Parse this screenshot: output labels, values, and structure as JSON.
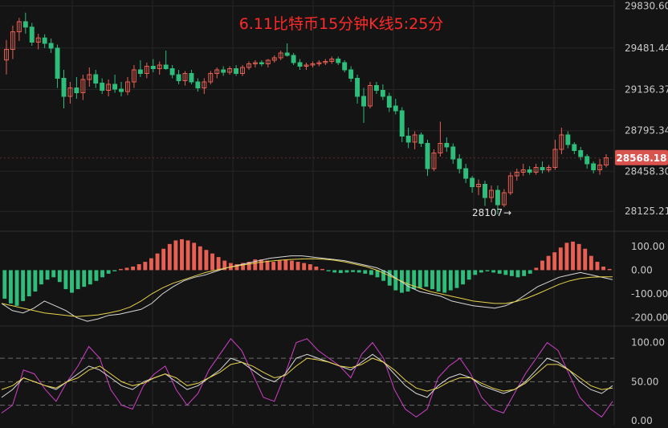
{
  "chart_data": {
    "type": "candlestick",
    "title": "6.11比特币15分钟K线5:25分",
    "colors": {
      "background": "#141414",
      "up": "#e85f53",
      "down": "#2ebd7a",
      "grid": "#262626",
      "fast_line": "#d8d8d8",
      "slow_line": "#e8d24a",
      "stoch_j": "#d040c8",
      "badge": "#d9534f"
    },
    "price_axis": {
      "ylim": [
        27960,
        29880
      ],
      "ticks": [
        "29830.60",
        "29481.44",
        "29136.37",
        "28795.34",
        "28458.30",
        "28125.21"
      ],
      "tick_values": [
        29830.6,
        29481.44,
        29136.37,
        28795.34,
        28458.3,
        28125.21
      ]
    },
    "current_price": {
      "label": "28568.18",
      "value": 28568.18
    },
    "low_annotation": {
      "label": "28107",
      "value": 28107
    },
    "candles": [
      [
        29382,
        29548,
        29262,
        29470
      ],
      [
        29470,
        29668,
        29390,
        29616
      ],
      [
        29616,
        29732,
        29540,
        29700
      ],
      [
        29700,
        29775,
        29600,
        29655
      ],
      [
        29655,
        29690,
        29500,
        29530
      ],
      [
        29530,
        29600,
        29470,
        29565
      ],
      [
        29565,
        29595,
        29480,
        29520
      ],
      [
        29520,
        29560,
        29440,
        29480
      ],
      [
        29480,
        29510,
        29150,
        29230
      ],
      [
        29230,
        29300,
        28980,
        29080
      ],
      [
        29080,
        29200,
        29020,
        29150
      ],
      [
        29150,
        29240,
        29060,
        29110
      ],
      [
        29110,
        29260,
        29050,
        29220
      ],
      [
        29220,
        29320,
        29160,
        29260
      ],
      [
        29260,
        29300,
        29150,
        29190
      ],
      [
        29190,
        29230,
        29100,
        29130
      ],
      [
        29130,
        29220,
        29080,
        29180
      ],
      [
        29180,
        29260,
        29110,
        29140
      ],
      [
        29140,
        29200,
        29080,
        29120
      ],
      [
        29120,
        29240,
        29090,
        29200
      ],
      [
        29200,
        29340,
        29150,
        29300
      ],
      [
        29300,
        29380,
        29240,
        29270
      ],
      [
        29270,
        29360,
        29230,
        29330
      ],
      [
        29330,
        29390,
        29280,
        29310
      ],
      [
        29310,
        29370,
        29260,
        29340
      ],
      [
        29340,
        29460,
        29300,
        29310
      ],
      [
        29310,
        29340,
        29230,
        29260
      ],
      [
        29260,
        29300,
        29180,
        29210
      ],
      [
        29210,
        29290,
        29170,
        29270
      ],
      [
        29270,
        29300,
        29180,
        29200
      ],
      [
        29200,
        29230,
        29120,
        29150
      ],
      [
        29150,
        29230,
        29100,
        29200
      ],
      [
        29200,
        29290,
        29180,
        29270
      ],
      [
        29270,
        29320,
        29230,
        29300
      ],
      [
        29300,
        29330,
        29250,
        29280
      ],
      [
        29280,
        29330,
        29260,
        29310
      ],
      [
        29310,
        29340,
        29250,
        29270
      ],
      [
        29270,
        29340,
        29250,
        29320
      ],
      [
        29320,
        29370,
        29300,
        29350
      ],
      [
        29350,
        29380,
        29320,
        29360
      ],
      [
        29360,
        29380,
        29330,
        29350
      ],
      [
        29350,
        29390,
        29320,
        29380
      ],
      [
        29380,
        29420,
        29360,
        29400
      ],
      [
        29400,
        29460,
        29380,
        29440
      ],
      [
        29440,
        29520,
        29410,
        29420
      ],
      [
        29420,
        29440,
        29340,
        29360
      ],
      [
        29360,
        29390,
        29300,
        29330
      ],
      [
        29330,
        29360,
        29300,
        29340
      ],
      [
        29340,
        29370,
        29320,
        29350
      ],
      [
        29350,
        29380,
        29330,
        29360
      ],
      [
        29360,
        29390,
        29340,
        29370
      ],
      [
        29370,
        29410,
        29350,
        29390
      ],
      [
        29390,
        29410,
        29340,
        29360
      ],
      [
        29360,
        29380,
        29280,
        29300
      ],
      [
        29300,
        29330,
        29200,
        29230
      ],
      [
        29230,
        29260,
        29020,
        29080
      ],
      [
        29080,
        29150,
        28860,
        29000
      ],
      [
        29000,
        29200,
        28980,
        29170
      ],
      [
        29170,
        29200,
        29100,
        29130
      ],
      [
        29130,
        29180,
        29050,
        29080
      ],
      [
        29080,
        29110,
        28950,
        28990
      ],
      [
        29000,
        29060,
        28930,
        28960
      ],
      [
        28960,
        28990,
        28700,
        28750
      ],
      [
        28750,
        28820,
        28650,
        28700
      ],
      [
        28700,
        28790,
        28640,
        28760
      ],
      [
        28760,
        28780,
        28660,
        28690
      ],
      [
        28690,
        28720,
        28420,
        28480
      ],
      [
        28480,
        28640,
        28460,
        28610
      ],
      [
        28610,
        28870,
        28580,
        28690
      ],
      [
        28690,
        28740,
        28620,
        28660
      ],
      [
        28660,
        28690,
        28520,
        28560
      ],
      [
        28560,
        28600,
        28440,
        28480
      ],
      [
        28480,
        28520,
        28360,
        28400
      ],
      [
        28400,
        28420,
        28280,
        28330
      ],
      [
        28330,
        28390,
        28260,
        28350
      ],
      [
        28350,
        28380,
        28170,
        28240
      ],
      [
        28240,
        28340,
        28200,
        28300
      ],
      [
        28300,
        28340,
        28100,
        28180
      ],
      [
        28180,
        28310,
        28160,
        28280
      ],
      [
        28280,
        28450,
        28260,
        28420
      ],
      [
        28420,
        28480,
        28380,
        28450
      ],
      [
        28450,
        28520,
        28420,
        28470
      ],
      [
        28470,
        28500,
        28430,
        28450
      ],
      [
        28450,
        28520,
        28430,
        28490
      ],
      [
        28490,
        28540,
        28440,
        28470
      ],
      [
        28470,
        28510,
        28450,
        28490
      ],
      [
        28490,
        28720,
        28470,
        28640
      ],
      [
        28640,
        28820,
        28600,
        28760
      ],
      [
        28760,
        28790,
        28650,
        28680
      ],
      [
        28680,
        28700,
        28600,
        28630
      ],
      [
        28630,
        28660,
        28550,
        28580
      ],
      [
        28580,
        28600,
        28480,
        28520
      ],
      [
        28520,
        28540,
        28440,
        28470
      ],
      [
        28470,
        28560,
        28430,
        28510
      ],
      [
        28510,
        28600,
        28490,
        28570
      ]
    ],
    "macd": {
      "axis_ticks": [
        "100.00",
        "0.00",
        "-100.00",
        "-200.00"
      ],
      "axis_values": [
        100,
        0,
        -100,
        -200
      ],
      "ylim": [
        -235,
        150
      ],
      "histogram": [
        -120,
        -140,
        -150,
        -130,
        -110,
        -90,
        -60,
        -40,
        -30,
        -50,
        -80,
        -95,
        -80,
        -70,
        -60,
        -45,
        -30,
        -15,
        -5,
        5,
        10,
        15,
        25,
        35,
        50,
        70,
        90,
        110,
        125,
        130,
        125,
        115,
        100,
        85,
        70,
        55,
        40,
        30,
        25,
        30,
        35,
        45,
        45,
        40,
        35,
        40,
        45,
        40,
        35,
        30,
        25,
        15,
        5,
        -5,
        -10,
        -12,
        -10,
        -8,
        -10,
        -15,
        -20,
        -30,
        -45,
        -65,
        -85,
        -95,
        -90,
        -80,
        -75,
        -70,
        -80,
        -90,
        -95,
        -85,
        -75,
        -60,
        -40,
        -20,
        -10,
        -5,
        -10,
        -15,
        -20,
        -25,
        -30,
        -25,
        -15,
        10,
        40,
        60,
        75,
        95,
        115,
        120,
        110,
        90,
        60,
        35,
        15,
        5
      ],
      "fast_line": [
        -140,
        -170,
        -180,
        -160,
        -130,
        -150,
        -170,
        -200,
        -215,
        -205,
        -190,
        -185,
        -175,
        -165,
        -140,
        -100,
        -70,
        -45,
        -30,
        -20,
        -5,
        10,
        20,
        30,
        40,
        50,
        55,
        60,
        60,
        55,
        50,
        45,
        40,
        30,
        20,
        10,
        -10,
        -40,
        -70,
        -90,
        -100,
        -110,
        -130,
        -140,
        -150,
        -155,
        -160,
        -150,
        -130,
        -100,
        -70,
        -50,
        -30,
        -20,
        -10,
        -20,
        -30,
        -40
      ],
      "slow_line": [
        -140,
        -150,
        -160,
        -170,
        -180,
        -185,
        -190,
        -195,
        -192,
        -188,
        -180,
        -170,
        -155,
        -130,
        -100,
        -75,
        -55,
        -40,
        -25,
        -10,
        0,
        10,
        18,
        25,
        32,
        38,
        42,
        45,
        47,
        48,
        46,
        42,
        35,
        25,
        15,
        0,
        -20,
        -40,
        -60,
        -75,
        -90,
        -100,
        -110,
        -120,
        -130,
        -135,
        -140,
        -140,
        -132,
        -118,
        -100,
        -80,
        -60,
        -45,
        -35,
        -30,
        -28,
        -28
      ]
    },
    "kdj": {
      "axis_ticks": [
        "100.00",
        "50.00",
        "0.00"
      ],
      "axis_values": [
        100,
        50,
        0
      ],
      "ylim": [
        -5,
        115
      ],
      "reference_lines": [
        80,
        50,
        20
      ],
      "k": [
        30,
        40,
        55,
        50,
        45,
        40,
        50,
        60,
        70,
        65,
        55,
        45,
        40,
        50,
        55,
        60,
        50,
        40,
        45,
        55,
        65,
        80,
        75,
        65,
        55,
        50,
        60,
        80,
        85,
        80,
        75,
        70,
        65,
        75,
        85,
        75,
        60,
        45,
        35,
        30,
        45,
        55,
        60,
        55,
        45,
        40,
        35,
        40,
        50,
        65,
        80,
        75,
        65,
        50,
        40,
        35,
        45
      ],
      "d": [
        40,
        45,
        55,
        50,
        45,
        42,
        50,
        55,
        65,
        70,
        60,
        50,
        45,
        48,
        55,
        60,
        55,
        45,
        48,
        55,
        62,
        72,
        75,
        70,
        62,
        55,
        58,
        70,
        80,
        78,
        75,
        70,
        68,
        72,
        80,
        75,
        65,
        52,
        42,
        38,
        42,
        50,
        55,
        55,
        48,
        42,
        38,
        40,
        48,
        60,
        72,
        72,
        65,
        55,
        45,
        40,
        42
      ],
      "j": [
        10,
        20,
        65,
        60,
        40,
        25,
        50,
        70,
        95,
        80,
        40,
        20,
        15,
        45,
        60,
        70,
        40,
        20,
        35,
        65,
        85,
        105,
        90,
        60,
        30,
        25,
        60,
        100,
        105,
        90,
        80,
        70,
        55,
        85,
        100,
        80,
        40,
        15,
        5,
        15,
        55,
        70,
        80,
        60,
        30,
        15,
        10,
        35,
        60,
        80,
        100,
        90,
        60,
        30,
        15,
        5,
        25
      ]
    }
  }
}
